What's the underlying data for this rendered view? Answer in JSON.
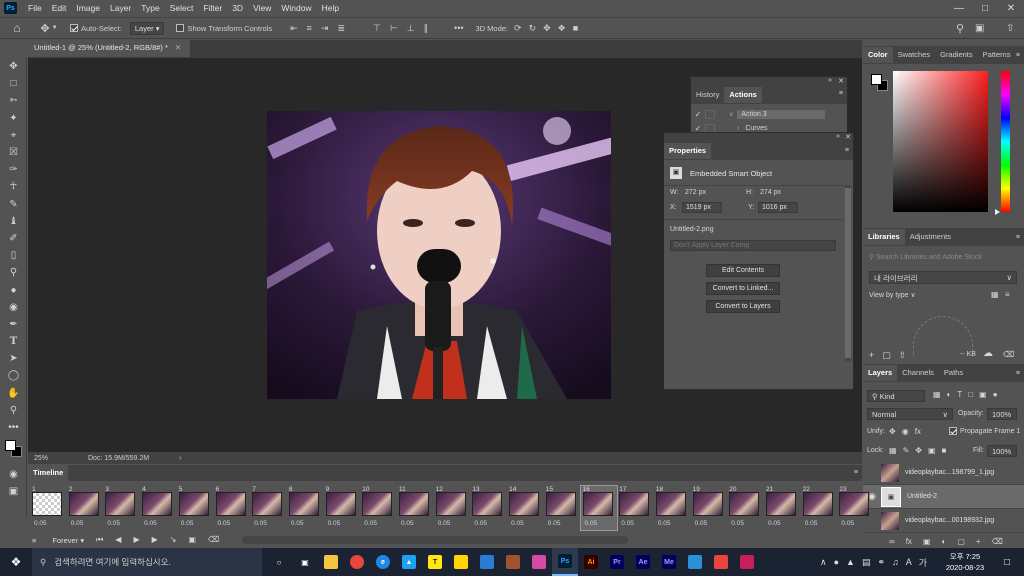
{
  "app": {
    "logo": "Ps",
    "title_tab": "Untitled-1 @ 25% (Untitled-2, RGB/8#) *"
  },
  "menu": [
    "File",
    "Edit",
    "Image",
    "Layer",
    "Type",
    "Select",
    "Filter",
    "3D",
    "View",
    "Window",
    "Help"
  ],
  "options": {
    "auto_select_label": "Auto-Select:",
    "auto_select_value": "Layer",
    "show_transform_label": "Show Transform Controls",
    "mode3d_label": "3D Mode:"
  },
  "status": {
    "zoom": "25%",
    "doc": "Doc: 15.9M/559.2M"
  },
  "history_panel": {
    "tabs": [
      "History",
      "Actions"
    ],
    "rows": [
      "Action 3",
      "Curves"
    ]
  },
  "properties": {
    "tab": "Properties",
    "type_label": "Embedded Smart Object",
    "w_label": "W:",
    "w_value": "272 px",
    "h_label": "H:",
    "h_value": "274 px",
    "x_label": "X:",
    "x_value": "1519 px",
    "y_label": "Y:",
    "y_value": "1016 px",
    "filename": "Untitled-2.png",
    "layer_comp_placeholder": "Don't Apply Layer Comp",
    "buttons": [
      "Edit Contents",
      "Convert to Linked...",
      "Convert to Layers"
    ]
  },
  "color_panel": {
    "tabs": [
      "Color",
      "Swatches",
      "Gradients",
      "Patterns"
    ],
    "hue_color": "#ff1e1e"
  },
  "libraries": {
    "tabs": [
      "Libraries",
      "Adjustments"
    ],
    "search_placeholder": "Search Libraries and Adobe Stock",
    "library_name": "내 라이브러리",
    "view_by": "View by type",
    "size": "-- KB"
  },
  "layers": {
    "tabs": [
      "Layers",
      "Channels",
      "Paths"
    ],
    "filter": "Kind",
    "blend": "Normal",
    "opacity_label": "Opacity:",
    "opacity": "100%",
    "unify_label": "Unify:",
    "propagate_label": "Propagate Frame 1",
    "lock_label": "Lock:",
    "fill_label": "Fill:",
    "fill": "100%",
    "rows": [
      {
        "name": "videoplaybac...198799_1.jpg"
      },
      {
        "name": "Untitled-2"
      },
      {
        "name": "videoplaybac...00198932.jpg"
      }
    ]
  },
  "timeline": {
    "title": "Timeline",
    "loop": "Forever",
    "frames": [
      {
        "n": "1",
        "d": "0.05"
      },
      {
        "n": "2",
        "d": "0.05"
      },
      {
        "n": "3",
        "d": "0.05"
      },
      {
        "n": "4",
        "d": "0.05"
      },
      {
        "n": "5",
        "d": "0.05"
      },
      {
        "n": "6",
        "d": "0.05"
      },
      {
        "n": "7",
        "d": "0.05"
      },
      {
        "n": "8",
        "d": "0.05"
      },
      {
        "n": "9",
        "d": "0.05"
      },
      {
        "n": "10",
        "d": "0.05"
      },
      {
        "n": "11",
        "d": "0.05"
      },
      {
        "n": "12",
        "d": "0.05"
      },
      {
        "n": "13",
        "d": "0.05"
      },
      {
        "n": "14",
        "d": "0.05"
      },
      {
        "n": "15",
        "d": "0.05"
      },
      {
        "n": "16",
        "d": "0.05"
      },
      {
        "n": "17",
        "d": "0.05"
      },
      {
        "n": "18",
        "d": "0.05"
      },
      {
        "n": "19",
        "d": "0.05"
      },
      {
        "n": "20",
        "d": "0.05"
      },
      {
        "n": "21",
        "d": "0.05"
      },
      {
        "n": "22",
        "d": "0.05"
      },
      {
        "n": "23",
        "d": "0.05"
      }
    ]
  },
  "taskbar": {
    "search_placeholder": "검색하려면 여기에 입력하십시오.",
    "ime": "A",
    "ime2": "가",
    "time": "오후 7:25",
    "date": "2020-08-23"
  }
}
